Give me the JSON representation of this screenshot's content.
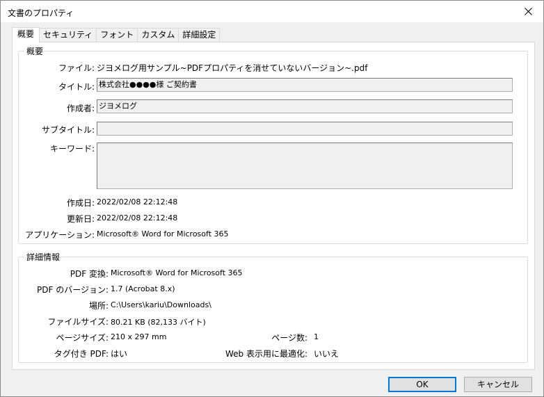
{
  "window": {
    "title": "文書のプロパティ",
    "close_icon": "close-icon"
  },
  "tabs": [
    {
      "label": "概要",
      "active": true
    },
    {
      "label": "セキュリティ",
      "active": false
    },
    {
      "label": "フォント",
      "active": false
    },
    {
      "label": "カスタム",
      "active": false
    },
    {
      "label": "詳細設定",
      "active": false
    }
  ],
  "summary": {
    "legend": "概要",
    "file_label": "ファイル:",
    "file_value": "ジヨメログ用サンプル~PDFプロパティを消せていないバージョン~.pdf",
    "title_label": "タイトル:",
    "title_value": "株式会社●●●●様 ご契約書",
    "author_label": "作成者:",
    "author_value": "ジヨメログ",
    "subject_label": "サブタイトル:",
    "subject_value": "",
    "keywords_label": "キーワード:",
    "keywords_value": "",
    "created_label": "作成日:",
    "created_value": "2022/02/08 22:12:48",
    "modified_label": "更新日:",
    "modified_value": "2022/02/08 22:12:48",
    "app_label": "アプリケーション:",
    "app_value": "Microsoft® Word for Microsoft 365"
  },
  "advanced": {
    "legend": "詳細情報",
    "producer_label": "PDF 変換:",
    "producer_value": "Microsoft® Word for Microsoft 365",
    "version_label": "PDF のバージョン:",
    "version_value": "1.7 (Acrobat 8.x)",
    "location_label": "場所:",
    "location_value": "C:\\Users\\kariu\\Downloads\\",
    "size_label": "ファイルサイズ:",
    "size_value": "80.21 KB (82,133 バイト)",
    "page_size_label": "ページサイズ:",
    "page_size_value": "210 x 297 mm",
    "pages_label": "ページ数:",
    "pages_value": "1",
    "tagged_label": "タグ付き PDF:",
    "tagged_value": "はい",
    "fast_web_label": "Web 表示用に最適化:",
    "fast_web_value": "いいえ"
  },
  "buttons": {
    "ok": "OK",
    "cancel": "キャンセル"
  }
}
